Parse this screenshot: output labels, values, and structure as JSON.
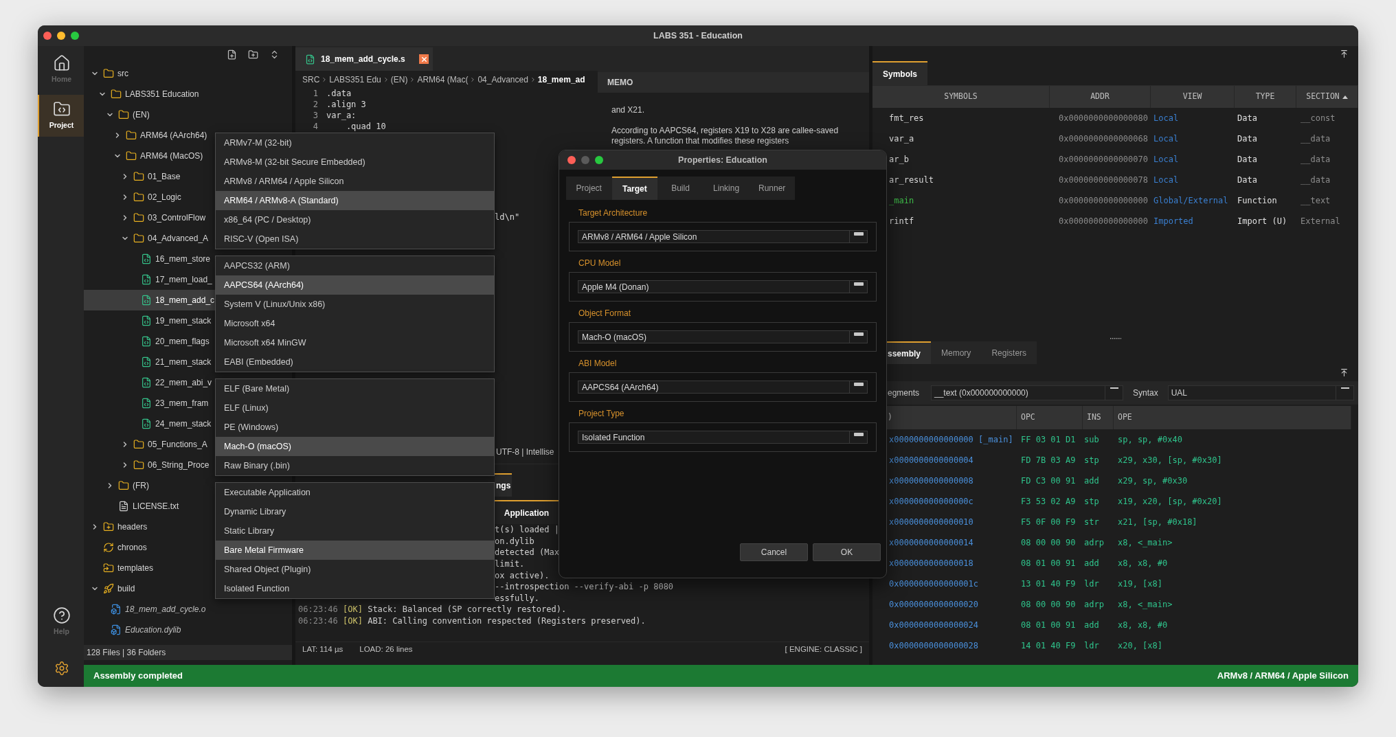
{
  "window": {
    "title": "LABS 351 - Education"
  },
  "activity_bar": [
    {
      "kind": "home",
      "label": "Home",
      "selected": false
    },
    {
      "kind": "project",
      "label": "Project",
      "selected": true
    },
    {
      "kind": "help",
      "label": "Help",
      "selected": false
    },
    {
      "kind": "settings",
      "selected": false
    }
  ],
  "explorer": {
    "tree": [
      {
        "label": "src",
        "kind": "folder",
        "expanded": true,
        "selected": false,
        "children": [
          {
            "label": "LABS351 Education",
            "kind": "folder",
            "expanded": true,
            "selected": false,
            "children": [
              {
                "label": "(EN)",
                "kind": "folder",
                "expanded": true,
                "selected": false,
                "children": [
                  {
                    "label": "ARM64 (AArch64)",
                    "kind": "folder",
                    "expanded": false,
                    "selected": false
                  },
                  {
                    "label": "ARM64 (MacOS)",
                    "kind": "folder",
                    "expanded": true,
                    "selected": false,
                    "children": [
                      {
                        "label": "01_Base",
                        "kind": "folder",
                        "expanded": false,
                        "selected": false
                      },
                      {
                        "label": "02_Logic",
                        "kind": "folder",
                        "expanded": false,
                        "selected": false
                      },
                      {
                        "label": "03_ControlFlow",
                        "kind": "folder",
                        "expanded": false,
                        "selected": false
                      },
                      {
                        "label": "04_Advanced_A",
                        "kind": "folder",
                        "expanded": true,
                        "selected": false,
                        "children": [
                          {
                            "label": "16_mem_store",
                            "kind": "asm",
                            "selected": false
                          },
                          {
                            "label": "17_mem_load_",
                            "kind": "asm",
                            "selected": false
                          },
                          {
                            "label": "18_mem_add_c",
                            "kind": "asm",
                            "selected": true
                          },
                          {
                            "label": "19_mem_stack",
                            "kind": "asm",
                            "selected": false
                          },
                          {
                            "label": "20_mem_flags",
                            "kind": "asm",
                            "selected": false
                          },
                          {
                            "label": "21_mem_stack",
                            "kind": "asm",
                            "selected": false
                          },
                          {
                            "label": "22_mem_abi_v",
                            "kind": "asm",
                            "selected": false
                          },
                          {
                            "label": "23_mem_fram",
                            "kind": "asm",
                            "selected": false
                          },
                          {
                            "label": "24_mem_stack",
                            "kind": "asm",
                            "selected": false
                          }
                        ]
                      },
                      {
                        "label": "05_Functions_A",
                        "kind": "folder",
                        "expanded": false,
                        "selected": false
                      },
                      {
                        "label": "06_String_Proce",
                        "kind": "folder",
                        "expanded": false,
                        "selected": false
                      }
                    ]
                  }
                ]
              },
              {
                "label": "(FR)",
                "kind": "folder",
                "expanded": false,
                "selected": false
              },
              {
                "label": "LICENSE.txt",
                "kind": "text",
                "selected": false
              }
            ]
          }
        ]
      },
      {
        "label": "headers",
        "kind": "folder_plus",
        "expanded": false,
        "selected": false
      },
      {
        "label": "chronos",
        "kind": "sync",
        "selected": false
      },
      {
        "label": "templates",
        "kind": "folder_link",
        "selected": false
      },
      {
        "label": "build",
        "kind": "rocket",
        "expanded": true,
        "selected": false,
        "children": [
          {
            "label": "18_mem_add_cycle.o",
            "kind": "binary",
            "selected": false
          },
          {
            "label": "Education.dylib",
            "kind": "binary",
            "selected": false
          }
        ]
      }
    ],
    "footer": "128 Files | 36 Folders"
  },
  "editor": {
    "tab": {
      "label": "18_mem_add_cycle.s",
      "selected": true
    },
    "breadcrumb": [
      "SRC",
      "LABS351 Edu",
      "(EN)",
      "ARM64 (Mac(",
      "04_Advanced",
      "18_mem_ad"
    ],
    "lines": [
      {
        "number": "1",
        "code": ".data"
      },
      {
        "number": "2",
        "code": ".align 3"
      },
      {
        "number": "3",
        "code": "var_a:"
      },
      {
        "number": "4",
        "code": "    .quad 10"
      }
    ],
    "fragment": "ld\\n\"",
    "status": "UTF-8 | Intellise"
  },
  "memo": {
    "title": "MEMO",
    "paragraphs": [
      "and X21.",
      "According to AAPCS64, registers X19 to X28 are callee-saved registers. A function that modifies these registers"
    ]
  },
  "output": {
    "tabs": [
      {
        "label": "ngs",
        "selected": true
      }
    ],
    "subtabs": [
      {
        "label": "Application",
        "selected": true
      }
    ],
    "lines": [
      {
        "kind": "fragment",
        "text": "t(s) loaded |"
      },
      {
        "kind": "fragment",
        "text": "on.dylib"
      },
      {
        "kind": "fragment",
        "text": "detected (Max"
      },
      {
        "kind": "fragment",
        "text": "limit."
      },
      {
        "kind": "fragment",
        "text": "ox active)."
      },
      {
        "kind": "fragment",
        "text": "--introspection --verify-abi -p 8080"
      },
      {
        "kind": "fragment",
        "text": "essfully."
      },
      {
        "kind": "entry",
        "time": "06:23:46",
        "tag": "[OK]",
        "message": "Stack: Balanced (SP correctly restored)."
      },
      {
        "kind": "entry",
        "time": "06:23:46",
        "tag": "[OK]",
        "message": "ABI: Calling convention respected (Registers preserved)."
      }
    ],
    "footer": {
      "latency": "LAT: 114 µs",
      "load": "LOAD: 26 lines",
      "engine": "[ ENGINE: CLASSIC ]"
    }
  },
  "symbols": {
    "tab": {
      "label": "Symbols",
      "selected": true
    },
    "columns": [
      "SYMBOLS",
      "ADDR",
      "VIEW",
      "TYPE",
      "SECTION"
    ],
    "rows": [
      {
        "symbol": "fmt_res",
        "kind": "data",
        "addr": "0x0000000000000080",
        "view": "Local",
        "type": "Data",
        "section": "__const"
      },
      {
        "symbol": "var_a",
        "kind": "data",
        "addr": "0x0000000000000068",
        "view": "Local",
        "type": "Data",
        "section": "__data"
      },
      {
        "symbol": "ar_b",
        "kind": "data",
        "addr": "0x0000000000000070",
        "view": "Local",
        "type": "Data",
        "section": "__data"
      },
      {
        "symbol": "ar_result",
        "kind": "data",
        "addr": "0x0000000000000078",
        "view": "Local",
        "type": "Data",
        "section": "__data"
      },
      {
        "symbol": "_main",
        "kind": "function",
        "addr": "0x0000000000000000",
        "view": "Global/External",
        "type": "Function",
        "section": "__text"
      },
      {
        "symbol": "rintf",
        "kind": "import",
        "addr": "0x0000000000000000",
        "view": "Imported",
        "type": "Import (U)",
        "section": "External"
      }
    ]
  },
  "assembly": {
    "tabs": [
      {
        "label": "ssembly",
        "selected": true
      },
      {
        "label": "Memory",
        "selected": false
      },
      {
        "label": "Registers",
        "selected": false
      }
    ],
    "segments_label": "egments",
    "segment": "__text (0x000000000000)",
    "syntax_label": "Syntax",
    "syntax": "UAL",
    "columns": [
      ")",
      "OPC",
      "INS",
      "OPE"
    ],
    "rows": [
      {
        "addr": "x0000000000000000",
        "label": "[_main]",
        "opc": "FF 03 01 D1",
        "ins": "sub",
        "ope": "sp, sp, #0x40"
      },
      {
        "addr": "x0000000000000004",
        "opc": "FD 7B 03 A9",
        "ins": "stp",
        "ope": "x29, x30, [sp, #0x30]"
      },
      {
        "addr": "x0000000000000008",
        "opc": "FD C3 00 91",
        "ins": "add",
        "ope": "x29, sp, #0x30"
      },
      {
        "addr": "x000000000000000c",
        "opc": "F3 53 02 A9",
        "ins": "stp",
        "ope": "x19, x20, [sp, #0x20]"
      },
      {
        "addr": "x0000000000000010",
        "opc": "F5 0F 00 F9",
        "ins": "str",
        "ope": "x21, [sp, #0x18]"
      },
      {
        "addr": "x0000000000000014",
        "opc": "08 00 00 90",
        "ins": "adrp",
        "ope": "x8, <_main>"
      },
      {
        "addr": "x0000000000000018",
        "opc": "08 01 00 91",
        "ins": "add",
        "ope": "x8, x8, #0"
      },
      {
        "addr": "0x000000000000001c",
        "opc": "13 01 40 F9",
        "ins": "ldr",
        "ope": "x19, [x8]"
      },
      {
        "addr": "0x0000000000000020",
        "opc": "08 00 00 90",
        "ins": "adrp",
        "ope": "x8, <_main>"
      },
      {
        "addr": "0x0000000000000024",
        "opc": "08 01 00 91",
        "ins": "add",
        "ope": "x8, x8, #0"
      },
      {
        "addr": "0x0000000000000028",
        "opc": "14 01 40 F9",
        "ins": "ldr",
        "ope": "x20, [x8]"
      }
    ]
  },
  "dropdowns": [
    {
      "items": [
        {
          "label": "ARMv7-M (32-bit)",
          "selected": false
        },
        {
          "label": "ARMv8-M (32-bit Secure Embedded)",
          "selected": false
        },
        {
          "label": "ARMv8 / ARM64 / Apple Silicon",
          "selected": false
        },
        {
          "label": "ARM64 / ARMv8-A (Standard)",
          "selected": true
        },
        {
          "label": "x86_64 (PC / Desktop)",
          "selected": false
        },
        {
          "label": "RISC-V (Open ISA)",
          "selected": false
        }
      ]
    },
    {
      "items": [
        {
          "label": "AAPCS32 (ARM)",
          "selected": false
        },
        {
          "label": "AAPCS64 (AArch64)",
          "selected": true
        },
        {
          "label": "System V (Linux/Unix x86)",
          "selected": false
        },
        {
          "label": "Microsoft x64",
          "selected": false
        },
        {
          "label": "Microsoft x64 MinGW",
          "selected": false
        },
        {
          "label": "EABI (Embedded)",
          "selected": false
        }
      ]
    },
    {
      "items": [
        {
          "label": "ELF (Bare Metal)",
          "selected": false
        },
        {
          "label": "ELF (Linux)",
          "selected": false
        },
        {
          "label": "PE (Windows)",
          "selected": false
        },
        {
          "label": "Mach-O (macOS)",
          "selected": true
        },
        {
          "label": "Raw Binary (.bin)",
          "selected": false
        }
      ]
    },
    {
      "items": [
        {
          "label": "Executable Application",
          "selected": false
        },
        {
          "label": "Dynamic Library",
          "selected": false
        },
        {
          "label": "Static Library",
          "selected": false
        },
        {
          "label": "Bare Metal Firmware",
          "selected": true
        },
        {
          "label": "Shared Object (Plugin)",
          "selected": false
        },
        {
          "label": "Isolated Function",
          "selected": false
        }
      ]
    }
  ],
  "dialog": {
    "title": "Properties: Education",
    "tabs": [
      {
        "label": "Project",
        "selected": false
      },
      {
        "label": "Target",
        "selected": true
      },
      {
        "label": "Build",
        "selected": false
      },
      {
        "label": "Linking",
        "selected": false
      },
      {
        "label": "Runner",
        "selected": false
      }
    ],
    "fields": [
      {
        "label": "Target Architecture",
        "value": "ARMv8 / ARM64 / Apple Silicon"
      },
      {
        "label": "CPU Model",
        "value": "Apple M4 (Donan)"
      },
      {
        "label": "Object Format",
        "value": "Mach-O (macOS)"
      },
      {
        "label": "ABI Model",
        "value": "AAPCS64 (AArch64)"
      },
      {
        "label": "Project Type",
        "value": "Isolated Function"
      }
    ],
    "buttons": [
      "Cancel",
      "OK"
    ]
  },
  "status_bar": {
    "message": "Assembly completed",
    "target": "ARMv8 / ARM64 / Apple Silicon"
  }
}
